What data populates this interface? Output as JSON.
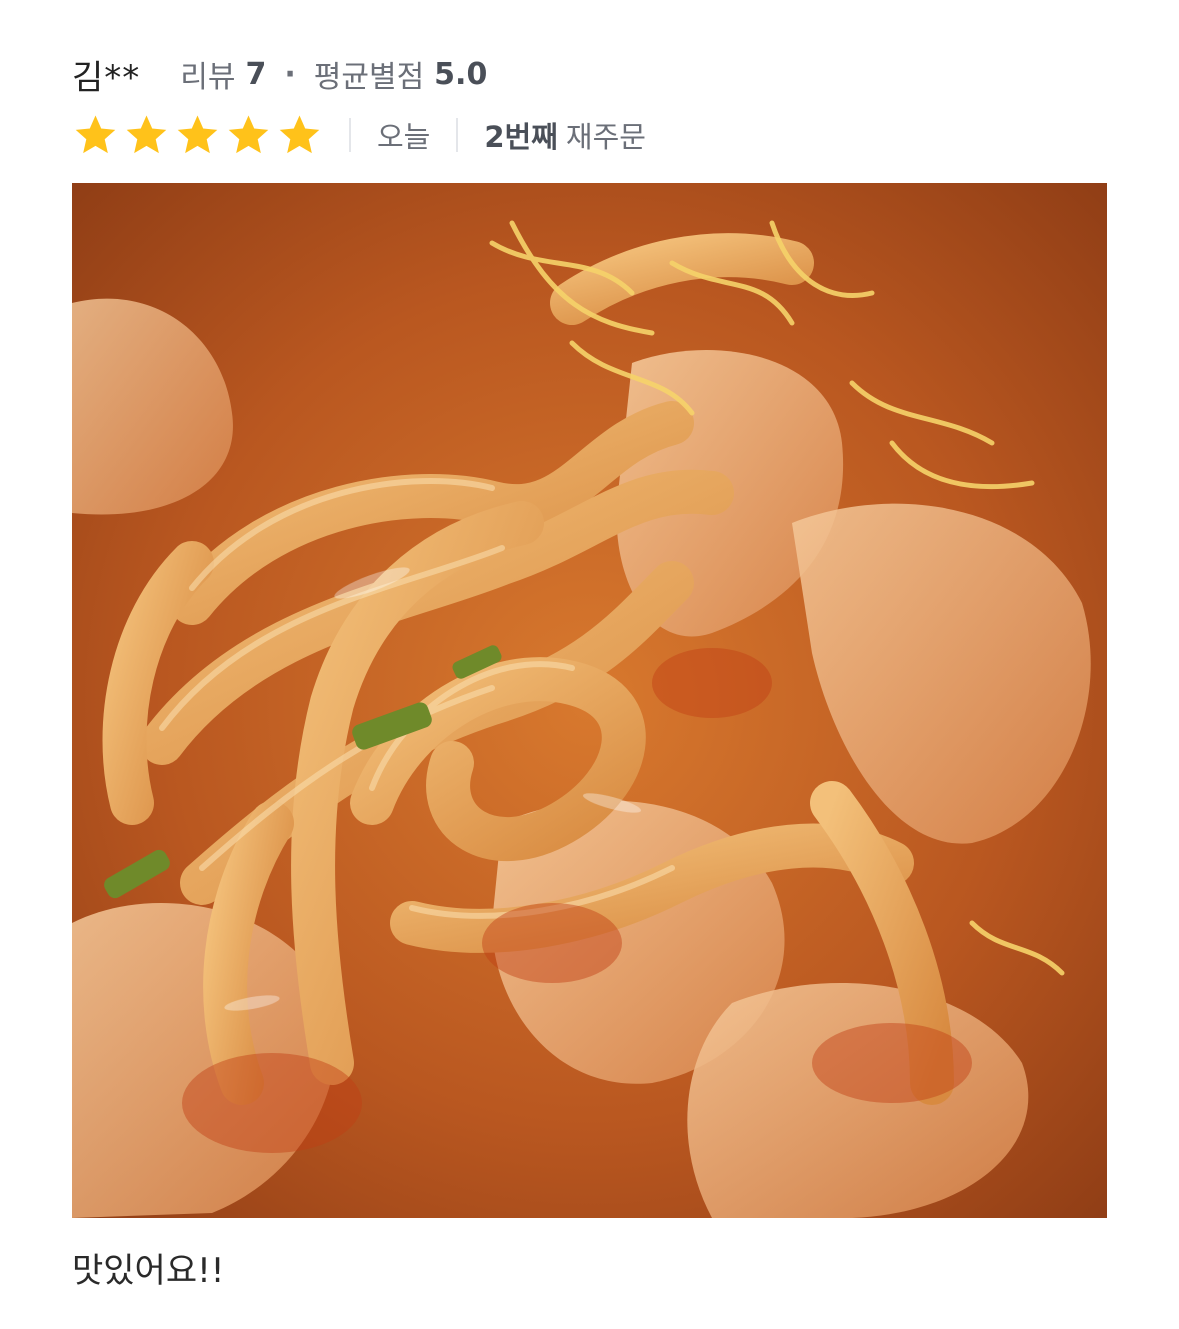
{
  "reviewer": {
    "name": "김**",
    "review_label": "리뷰",
    "review_count": "7",
    "separator": "·",
    "average_label": "평균별점",
    "average_rating": "5.0"
  },
  "meta": {
    "rating": 5,
    "rating_max": 5,
    "star_color": "#FFC21A",
    "date": "오늘",
    "reorder_count": "2번째",
    "reorder_label": "재주문"
  },
  "photo": {
    "subject_icon": "food-photo"
  },
  "review": {
    "text": "맛있어요!!"
  }
}
